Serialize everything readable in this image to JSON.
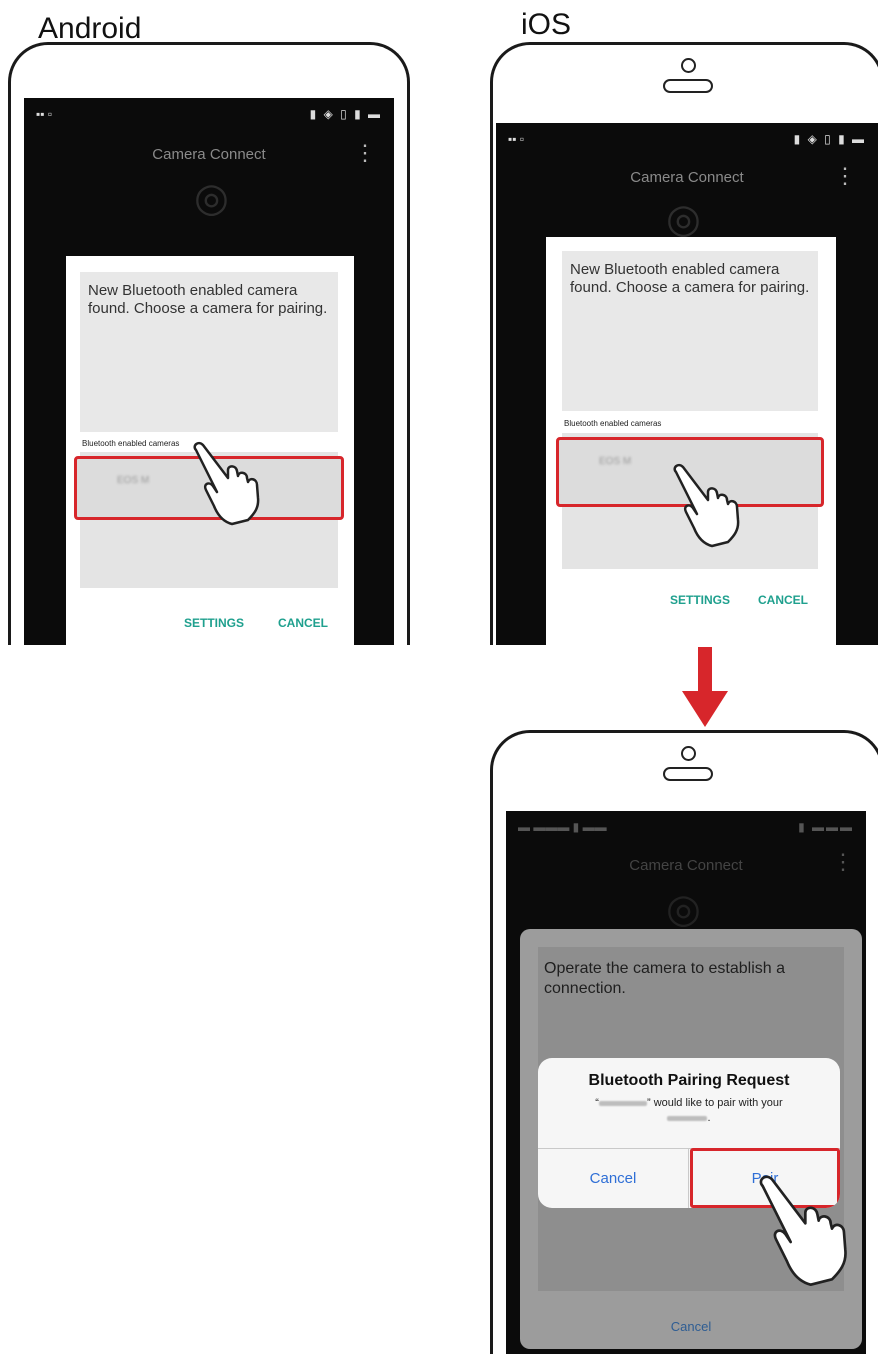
{
  "labels": {
    "android": "Android",
    "ios": "iOS"
  },
  "app": {
    "title": "Camera Connect"
  },
  "selection_dialog": {
    "message": "New Bluetooth enabled camera found. Choose a camera for pairing.",
    "cameras_label": "Bluetooth enabled cameras",
    "camera_name": "EOS M",
    "settings_button": "SETTINGS",
    "cancel_button": "CANCEL"
  },
  "pairing_screen": {
    "sheet_message": "Operate the camera to establish a connection.",
    "sheet_cancel": "Cancel",
    "alert": {
      "title": "Bluetooth Pairing Request",
      "message_suffix": "” would like to pair with your",
      "message_open": "“",
      "cancel_button": "Cancel",
      "pair_button": "Pair"
    }
  },
  "colors": {
    "highlight": "#d7262b",
    "accent_teal": "#1fa08e",
    "ios_blue": "#2f6fd6"
  },
  "icons": [
    "hand-pointer-icon",
    "down-arrow-icon",
    "overflow-menu-icon",
    "camera-icon"
  ]
}
